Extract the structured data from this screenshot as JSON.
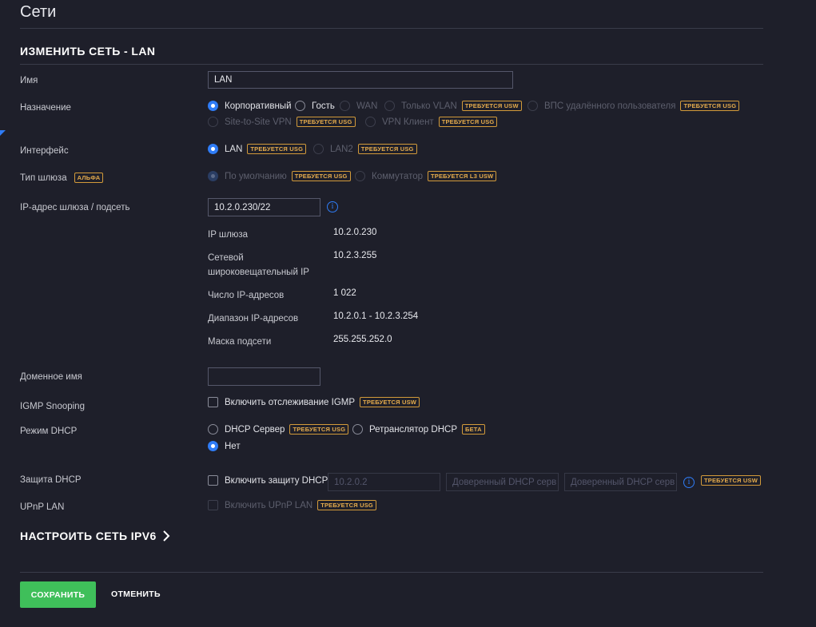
{
  "page_title": "Сети",
  "section_title": "ИЗМЕНИТЬ СЕТЬ - LAN",
  "name": {
    "label": "Имя",
    "value": "LAN"
  },
  "purpose": {
    "label": "Назначение",
    "options": [
      {
        "label": "Корпоративный",
        "checked": true,
        "disabled": false,
        "badge": ""
      },
      {
        "label": "Гость",
        "checked": false,
        "disabled": false,
        "badge": ""
      },
      {
        "label": "WAN",
        "checked": false,
        "disabled": true,
        "badge": ""
      },
      {
        "label": "Только VLAN",
        "checked": false,
        "disabled": true,
        "badge": "ТРЕБУЕТСЯ USW"
      },
      {
        "label": "ВПС удалённого пользователя",
        "checked": false,
        "disabled": true,
        "badge": "ТРЕБУЕТСЯ USG"
      },
      {
        "label": "Site-to-Site VPN",
        "checked": false,
        "disabled": true,
        "badge": "ТРЕБУЕТСЯ USG"
      },
      {
        "label": "VPN Клиент",
        "checked": false,
        "disabled": true,
        "badge": "ТРЕБУЕТСЯ USG"
      }
    ]
  },
  "interface": {
    "label": "Интерфейс",
    "options": [
      {
        "label": "LAN",
        "checked": true,
        "disabled": false,
        "badge": "ТРЕБУЕТСЯ USG"
      },
      {
        "label": "LAN2",
        "checked": false,
        "disabled": true,
        "badge": "ТРЕБУЕТСЯ USG"
      }
    ]
  },
  "gateway_type": {
    "label": "Тип шлюза",
    "label_badge": "АЛЬФА",
    "options": [
      {
        "label": "По умолчанию",
        "checked": true,
        "disabled": true,
        "badge": "ТРЕБУЕТСЯ USG"
      },
      {
        "label": "Коммутатор",
        "checked": false,
        "disabled": true,
        "badge": "ТРЕБУЕТСЯ L3 USW"
      }
    ]
  },
  "gateway_subnet": {
    "label": "IP-адрес шлюза / подсеть",
    "value": "10.2.0.230/22",
    "info_icon": "info-icon",
    "details": [
      {
        "key": "IP шлюза",
        "value": "10.2.0.230"
      },
      {
        "key": "Сетевой широковещательный IP",
        "value": "10.2.3.255"
      },
      {
        "key": "Число IP-адресов",
        "value": "1 022"
      },
      {
        "key": "Диапазон IP-адресов",
        "value": "10.2.0.1 - 10.2.3.254"
      },
      {
        "key": "Маска подсети",
        "value": "255.255.252.0"
      }
    ]
  },
  "domain_name": {
    "label": "Доменное имя",
    "value": ""
  },
  "igmp": {
    "label": "IGMP Snooping",
    "checkbox_label": "Включить отслеживание IGMP",
    "checked": false,
    "badge": "ТРЕБУЕТСЯ USW"
  },
  "dhcp_mode": {
    "label": "Режим DHCP",
    "options": [
      {
        "label": "DHCP Сервер",
        "checked": false,
        "disabled": false,
        "badge": "ТРЕБУЕТСЯ USG"
      },
      {
        "label": "Ретранслятор DHCP",
        "checked": false,
        "disabled": false,
        "badge": "БЕТА"
      },
      {
        "label": "Нет",
        "checked": true,
        "disabled": false,
        "badge": ""
      }
    ]
  },
  "dhcp_guard": {
    "label": "Защита DHCP",
    "checkbox_label": "Включить защиту DHCP",
    "checked": false,
    "fields": [
      {
        "value": "10.2.0.2",
        "placeholder": ""
      },
      {
        "value": "",
        "placeholder": "Доверенный DHCP серв"
      },
      {
        "value": "",
        "placeholder": "Доверенный DHCP серв"
      }
    ],
    "badge": "ТРЕБУЕТСЯ USW"
  },
  "upnp": {
    "label": "UPnP LAN",
    "checkbox_label": "Включить UPnP LAN",
    "checked": false,
    "badge": "ТРЕБУЕТСЯ USG"
  },
  "ipv6_link": {
    "label": "НАСТРОИТЬ СЕТЬ IPV6",
    "icon": "chevron-right-icon"
  },
  "buttons": {
    "save": "СОХРАНИТЬ",
    "cancel": "ОТМЕНИТЬ"
  },
  "colors": {
    "background": "#1e1f2a",
    "accent": "#2f7cf6",
    "save": "#3fbf5a",
    "badge": "#e4ab4c"
  }
}
